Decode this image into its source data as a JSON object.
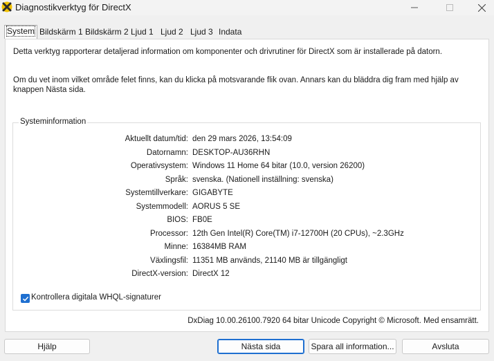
{
  "window": {
    "title": "Diagnostikverktyg för DirectX"
  },
  "tabs": [
    "System",
    "Bildskärm 1",
    "Bildskärm 2",
    "Ljud 1",
    "Ljud 2",
    "Ljud 3",
    "Indata"
  ],
  "active_tab": "System",
  "intro": {
    "line1": "Detta verktyg rapporterar detaljerad information om komponenter och drivrutiner för DirectX som är installerade på datorn.",
    "line2": "Om du vet inom vilket område felet finns, kan du klicka på motsvarande flik ovan. Annars kan du bläddra dig fram med hjälp av knappen Nästa sida."
  },
  "system_info": {
    "title": "Systeminformation",
    "rows": [
      {
        "label": "Aktuellt datum/tid:",
        "value": "den 29 mars 2026, 13:54:09"
      },
      {
        "label": "Datornamn:",
        "value": "DESKTOP-AU36RHN"
      },
      {
        "label": "Operativsystem:",
        "value": "Windows 11 Home 64 bitar (10.0, version 26200)"
      },
      {
        "label": "Språk:",
        "value": "svenska. (Nationell inställning: svenska)"
      },
      {
        "label": "Systemtillverkare:",
        "value": "GIGABYTE"
      },
      {
        "label": "Systemmodell:",
        "value": "AORUS 5 SE"
      },
      {
        "label": "BIOS:",
        "value": "FB0E"
      },
      {
        "label": "Processor:",
        "value": "12th Gen Intel(R) Core(TM) i7-12700H (20 CPUs), ~2.3GHz"
      },
      {
        "label": "Minne:",
        "value": "16384MB RAM"
      },
      {
        "label": "Växlingsfil:",
        "value": "11351 MB används, 21140 MB är tillgängligt"
      },
      {
        "label": "DirectX-version:",
        "value": "DirectX 12"
      }
    ]
  },
  "whql_check": {
    "label": "Kontrollera digitala WHQL-signaturer",
    "checked": true
  },
  "version_line": "DxDiag 10.00.26100.7920 64 bitar Unicode  Copyright © Microsoft. Med ensamrätt.",
  "buttons": {
    "help": "Hjälp",
    "next": "Nästa sida",
    "save": "Spara all information...",
    "exit": "Avsluta"
  },
  "colors": {
    "accent": "#1e6fd0"
  }
}
